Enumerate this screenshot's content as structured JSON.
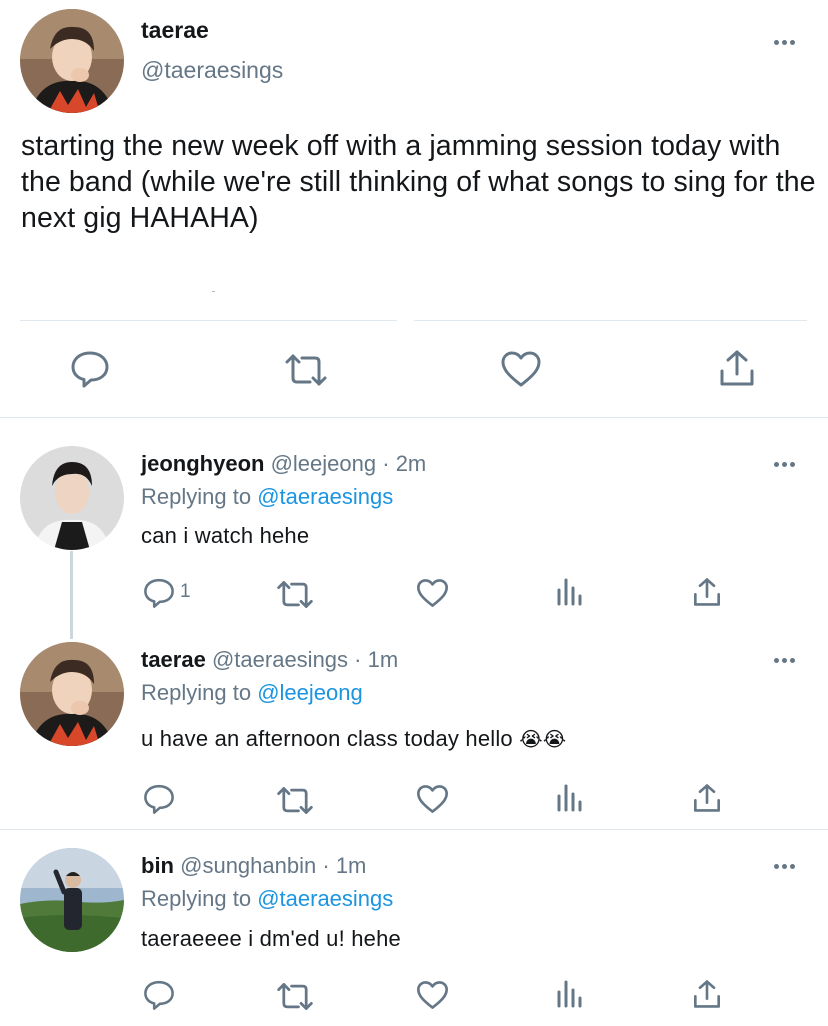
{
  "main_tweet": {
    "display_name": "taerae",
    "handle": "@taeraesings",
    "text": "starting the new week off with a jamming session today with the band (while we're still thinking of what songs to sing for the next gig HAHAHA)",
    "actions": [
      "comment-icon",
      "retweet-icon",
      "like-icon",
      "share-icon"
    ]
  },
  "replies": [
    {
      "display_name": "jeonghyeon",
      "handle": "@leejeong",
      "separator": "·",
      "time": "2m",
      "replying_label": "Replying to",
      "replying_to": "@taeraesings",
      "text": "can i watch hehe",
      "reply_count": "1"
    },
    {
      "display_name": "taerae",
      "handle": "@taeraesings",
      "separator": "·",
      "time": "1m",
      "replying_label": "Replying to",
      "replying_to": "@leejeong",
      "text": "u have an afternoon class today hello",
      "emoji": "😭😭",
      "reply_count": ""
    },
    {
      "display_name": "bin",
      "handle": "@sunghanbin",
      "separator": "·",
      "time": "1m",
      "replying_label": "Replying to",
      "replying_to": "@taeraesings",
      "text": "taeraeeee i dm'ed u! hehe",
      "reply_count": ""
    }
  ],
  "colors": {
    "text": "#14171a",
    "muted": "#657786",
    "link": "#1b95e0",
    "divider": "#e1e8ed"
  }
}
